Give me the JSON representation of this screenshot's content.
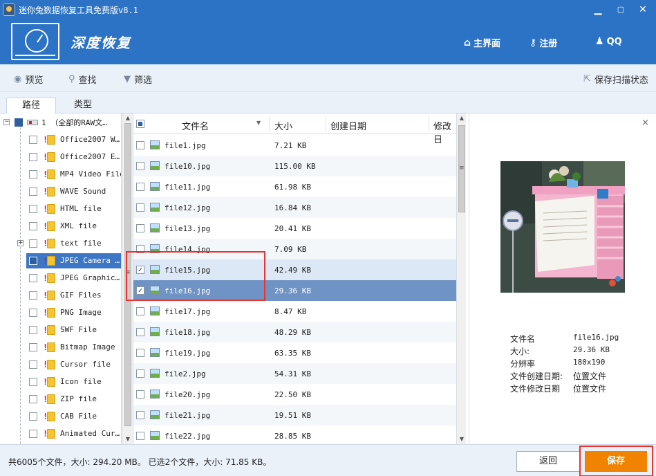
{
  "window": {
    "title": "迷你兔数据恢复工具免费版v8.1"
  },
  "header": {
    "brand": "深度恢复",
    "nav": [
      {
        "label": "主界面",
        "icon": "home-icon"
      },
      {
        "label": "注册",
        "icon": "key-icon"
      },
      {
        "label": "QQ",
        "icon": "qq-icon"
      }
    ]
  },
  "toolbar": {
    "preview": "预览",
    "search": "查找",
    "filter": "筛选",
    "save_scan": "保存扫描状态"
  },
  "tabs": [
    "路径",
    "类型"
  ],
  "tree": {
    "root": "1 （全部的RAW文…",
    "items": [
      "Office2007 W…",
      "Office2007 E…",
      "MP4 Video File",
      "WAVE Sound",
      "HTML file",
      "XML file",
      "text file",
      "JPEG Camera …",
      "JPEG Graphic…",
      "GIF Files",
      "PNG Image",
      "SWF File",
      "Bitmap Image",
      "Cursor file",
      "Icon file",
      "ZIP file",
      "CAB File",
      "Animated Cur…"
    ]
  },
  "filelist": {
    "columns": [
      "文件名",
      "大小",
      "创建日期",
      "修改日"
    ],
    "rows": [
      {
        "name": "file1.jpg",
        "size": "7.21 KB"
      },
      {
        "name": "file10.jpg",
        "size": "115.00 KB"
      },
      {
        "name": "file11.jpg",
        "size": "61.98 KB"
      },
      {
        "name": "file12.jpg",
        "size": "16.84 KB"
      },
      {
        "name": "file13.jpg",
        "size": "20.41 KB"
      },
      {
        "name": "file14.jpg",
        "size": "7.09 KB"
      },
      {
        "name": "file15.jpg",
        "size": "42.49 KB"
      },
      {
        "name": "file16.jpg",
        "size": "29.36 KB"
      },
      {
        "name": "file17.jpg",
        "size": "8.47 KB"
      },
      {
        "name": "file18.jpg",
        "size": "48.29 KB"
      },
      {
        "name": "file19.jpg",
        "size": "63.35 KB"
      },
      {
        "name": "file2.jpg",
        "size": "54.31 KB"
      },
      {
        "name": "file20.jpg",
        "size": "22.50 KB"
      },
      {
        "name": "file21.jpg",
        "size": "19.51 KB"
      },
      {
        "name": "file22.jpg",
        "size": "28.85 KB"
      }
    ]
  },
  "preview": {
    "close": "×",
    "info": [
      {
        "key": "文件名",
        "value": "file16.jpg"
      },
      {
        "key": "大小:",
        "value": "29.36 KB"
      },
      {
        "key": "分辨率",
        "value": "180x190"
      },
      {
        "key": "文件创建日期:",
        "value": "位置文件"
      },
      {
        "key": "文件修改日期",
        "value": "位置文件"
      }
    ]
  },
  "status": {
    "summary": "共6005个文件，大小: 294.20 MB。 已选2个文件，大小: 71.85 KB。"
  },
  "buttons": {
    "back": "返回",
    "save": "保存"
  },
  "colors": {
    "brand_blue": "#2c73c6",
    "save_orange": "#f08300",
    "highlight_red": "#e8332e"
  }
}
